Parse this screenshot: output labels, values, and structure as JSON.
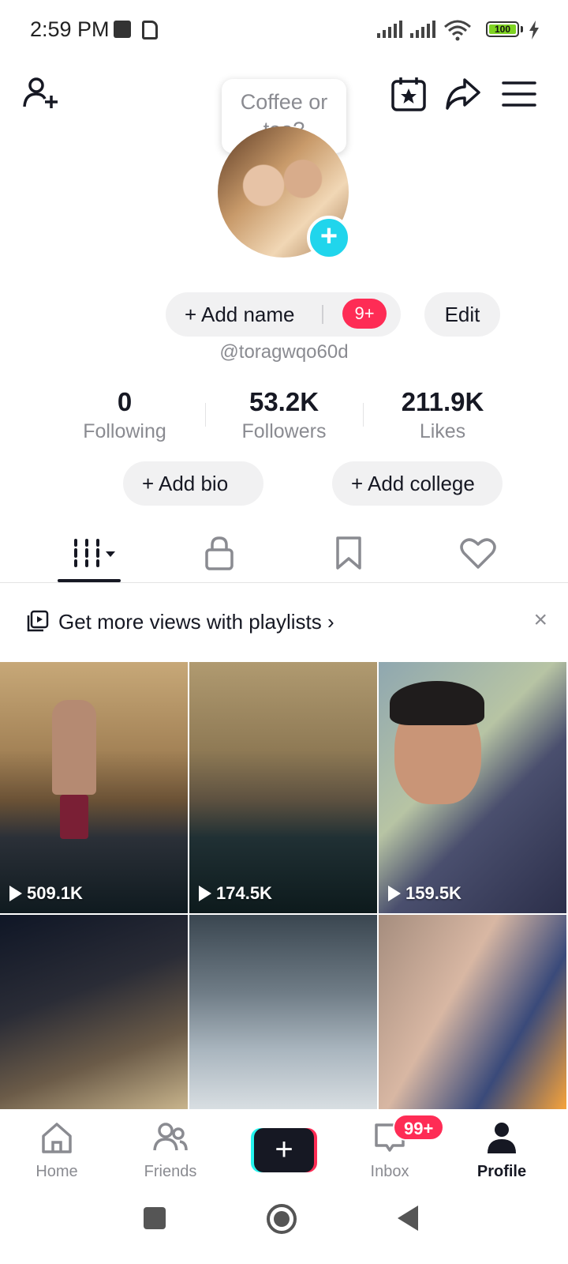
{
  "status_bar": {
    "time": "2:59 PM",
    "battery": "100"
  },
  "tooltip": {
    "text": "Coffee or tea?"
  },
  "profile": {
    "add_name_label": "+ Add name",
    "notification_badge": "9+",
    "edit_label": "Edit",
    "username": "@toragwqo60d",
    "add_bio_label": "+ Add bio",
    "add_college_label": "+ Add college"
  },
  "stats": [
    {
      "value": "0",
      "label": "Following"
    },
    {
      "value": "53.2K",
      "label": "Followers"
    },
    {
      "value": "211.9K",
      "label": "Likes"
    }
  ],
  "banner": {
    "text": "Get more views with playlists",
    "chevron": "›",
    "close": "×"
  },
  "videos": [
    {
      "views": "509.1K"
    },
    {
      "views": "174.5K"
    },
    {
      "views": "159.5K"
    },
    {
      "views": ""
    },
    {
      "views": ""
    },
    {
      "views": ""
    }
  ],
  "bottom_nav": {
    "home": "Home",
    "friends": "Friends",
    "create": "+",
    "inbox": "Inbox",
    "inbox_badge": "99+",
    "profile": "Profile"
  },
  "colors": {
    "accent_pink": "#fe2c55",
    "accent_cyan": "#25f4ee",
    "avatar_plus": "#20d5ec",
    "text_primary": "#161823",
    "text_secondary": "#8a8b91"
  }
}
